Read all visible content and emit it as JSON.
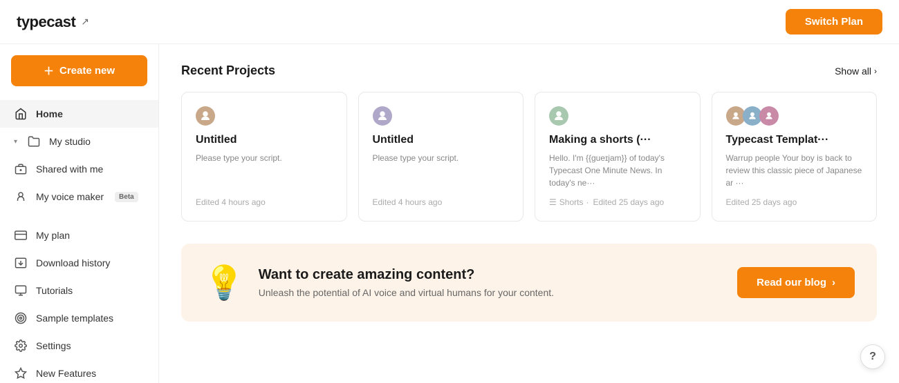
{
  "header": {
    "logo_text": "typecast",
    "logo_icon": "↗",
    "switch_plan_label": "Switch Plan"
  },
  "sidebar": {
    "create_new_label": "Create new",
    "items": [
      {
        "id": "home",
        "label": "Home",
        "icon": "home",
        "active": true
      },
      {
        "id": "my-studio",
        "label": "My studio",
        "icon": "folder",
        "chevron": true
      },
      {
        "id": "shared-with-me",
        "label": "Shared with me",
        "icon": "person-share"
      },
      {
        "id": "my-voice-maker",
        "label": "My voice maker",
        "icon": "person-mic",
        "beta": true
      },
      {
        "id": "my-plan",
        "label": "My plan",
        "icon": "credit-card"
      },
      {
        "id": "download-history",
        "label": "Download history",
        "icon": "download-box"
      },
      {
        "id": "tutorials",
        "label": "Tutorials",
        "icon": "monitor"
      },
      {
        "id": "sample-templates",
        "label": "Sample templates",
        "icon": "target"
      },
      {
        "id": "settings",
        "label": "Settings",
        "icon": "gear"
      },
      {
        "id": "new-features",
        "label": "New Features",
        "icon": "star"
      }
    ]
  },
  "main": {
    "recent_projects_title": "Recent Projects",
    "show_all_label": "Show all",
    "projects": [
      {
        "id": 1,
        "title": "Untitled",
        "script": "Please type your script.",
        "edited": "Edited 4 hours ago",
        "type": null,
        "avatar_count": 1,
        "avatar_color": "#c9a88a"
      },
      {
        "id": 2,
        "title": "Untitled",
        "script": "Please type your script.",
        "edited": "Edited 4 hours ago",
        "type": null,
        "avatar_count": 1,
        "avatar_color": "#b0a8c9"
      },
      {
        "id": 3,
        "title": "Making a shorts (···",
        "script": "Hello. I'm {{gueɪjam}} of today's Typecast One Minute News. In today's ne···",
        "edited": "Edited 25 days ago",
        "type": "Shorts",
        "avatar_count": 1,
        "avatar_color": "#a8c9b0"
      },
      {
        "id": 4,
        "title": "Typecast Templat···",
        "script": "Warrup people Your boy is back to review this classic piece of Japanese ar ···",
        "edited": "Edited 25 days ago",
        "type": null,
        "avatar_count": 3,
        "avatar_color": "#c9a88a"
      }
    ],
    "blog_banner": {
      "emoji": "💡",
      "title": "Want to create amazing content?",
      "subtitle": "Unleash the potential of AI voice and virtual humans for your content.",
      "button_label": "Read our blog"
    },
    "help_label": "?"
  }
}
